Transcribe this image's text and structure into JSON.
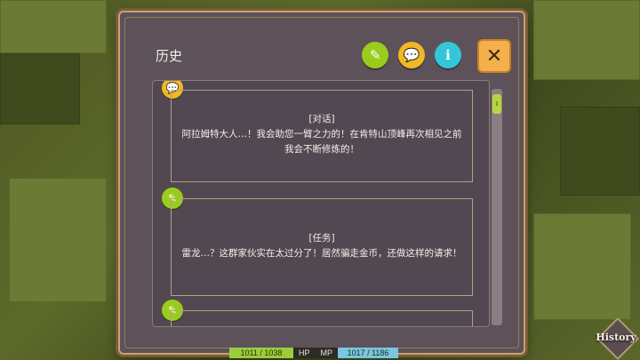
{
  "panel": {
    "title": "历史",
    "filter_buttons": [
      {
        "name": "quest-filter",
        "icon": "quest-icon"
      },
      {
        "name": "chat-filter",
        "icon": "chat-bubble-icon"
      },
      {
        "name": "info-filter",
        "icon": "info-icon",
        "glyph": "i"
      }
    ],
    "close_icon": "close-icon"
  },
  "entries": [
    {
      "type": "chat",
      "tag": "[对话]",
      "text": "阿拉姆特大人…！我会助您一臂之力的！在肯特山顶峰再次相见之前我会不断修炼的！"
    },
    {
      "type": "quest",
      "tag": "[任务]",
      "text": "雷龙…？这群家伙实在太过分了！居然骗走金币，还做这样的请求！"
    },
    {
      "type": "quest",
      "tag": "",
      "text": ""
    }
  ],
  "hud": {
    "hp_value": "1011 / 1038",
    "hp_label": "HP",
    "mp_label": "MP",
    "mp_value": "1017 / 1186"
  },
  "history_button": {
    "label": "History"
  },
  "colors": {
    "quest": "#9acc1e",
    "chat": "#f0b825",
    "info": "#33c6d8",
    "close": "#f4b04a"
  }
}
